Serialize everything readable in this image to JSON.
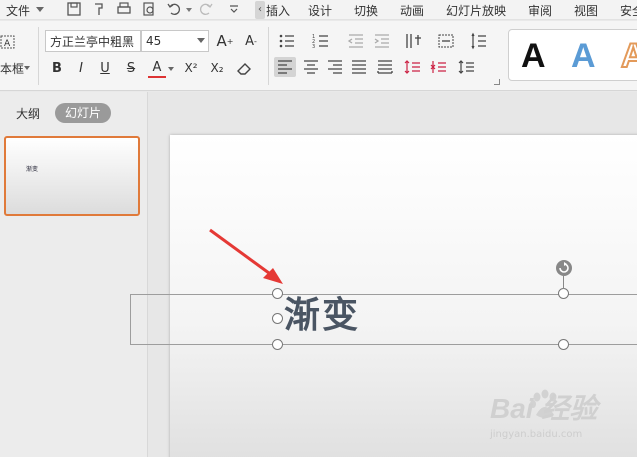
{
  "menu": {
    "file": "文件",
    "tabs": [
      "插入",
      "设计",
      "切换",
      "动画",
      "幻灯片放映",
      "审阅",
      "视图",
      "安全"
    ]
  },
  "quick_access": [
    "save-icon",
    "format-painter-icon",
    "print-icon",
    "print-preview-icon",
    "undo-icon",
    "redo-icon",
    "customize-icon"
  ],
  "ribbon": {
    "textbox_label": "本框",
    "font_name": "方正兰亭中粗黑",
    "font_size": "45",
    "grow_font": "A",
    "shrink_font": "A",
    "bold": "B",
    "italic": "I",
    "underline": "U",
    "strike": "S",
    "font_color": "A",
    "superscript": "X²",
    "subscript": "X₂",
    "style_gallery": [
      "A",
      "A",
      "A"
    ]
  },
  "panel": {
    "outline_tab": "大纲",
    "slides_tab": "幻灯片",
    "thumbnail_text": "渐变"
  },
  "slide": {
    "title": "渐变"
  },
  "watermark": {
    "brand": "Bai 经验",
    "url": "jingyan.baidu.com"
  },
  "colors": {
    "accent": "#e07a3a",
    "title_text": "#4a5563",
    "annotation_arrow": "#e53935",
    "gallery_blue": "#5b9bd5",
    "gallery_orange": "#e39a5a"
  }
}
